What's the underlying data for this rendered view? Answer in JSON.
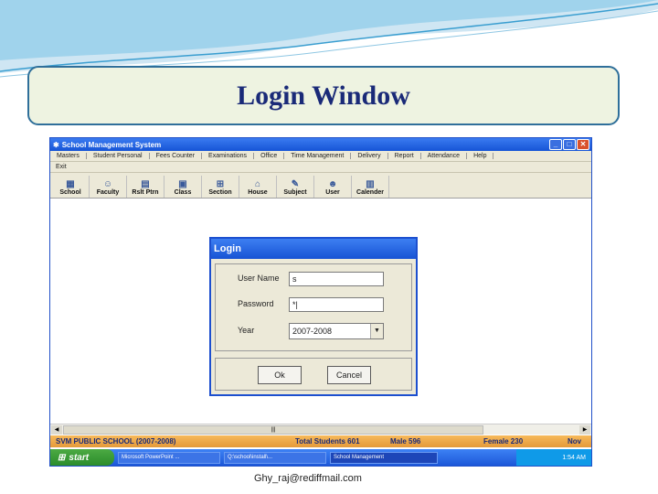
{
  "slide": {
    "title": "Login Window",
    "footer_email": "Ghy_raj@rediffmail.com"
  },
  "app": {
    "window_title": "School Management System",
    "menu": [
      "Masters",
      "Student Personal",
      "Fees Counter",
      "Examinations",
      "Office",
      "Time Management",
      "Delivery",
      "Report",
      "Attendance",
      "Help"
    ],
    "menu2": "Exit",
    "toolbar": [
      {
        "label": "School",
        "icon": "school-icon"
      },
      {
        "label": "Faculty",
        "icon": "faculty-icon"
      },
      {
        "label": "Rslt Ptrn",
        "icon": "result-pattern-icon"
      },
      {
        "label": "Class",
        "icon": "class-icon"
      },
      {
        "label": "Section",
        "icon": "section-icon"
      },
      {
        "label": "House",
        "icon": "house-icon"
      },
      {
        "label": "Subject",
        "icon": "subject-icon"
      },
      {
        "label": "User",
        "icon": "user-icon"
      },
      {
        "label": "Calender",
        "icon": "calendar-icon"
      }
    ],
    "statusbar": {
      "school": "SVM PUBLIC SCHOOL (2007-2008)",
      "total": "Total Students  601",
      "male": "Male  596",
      "female": "Female  230",
      "mode": "Nov"
    },
    "taskbar": {
      "start": "start",
      "tasks": [
        "Microsoft PowerPoint ...",
        "Q:\\school\\install\\...",
        "School Management"
      ],
      "time": "1:54 AM"
    }
  },
  "login": {
    "title": "Login",
    "username_label": "User Name",
    "username_value": "s",
    "password_label": "Password",
    "password_value": "*|",
    "year_label": "Year",
    "year_value": "2007-2008",
    "ok_label": "Ok",
    "cancel_label": "Cancel"
  }
}
